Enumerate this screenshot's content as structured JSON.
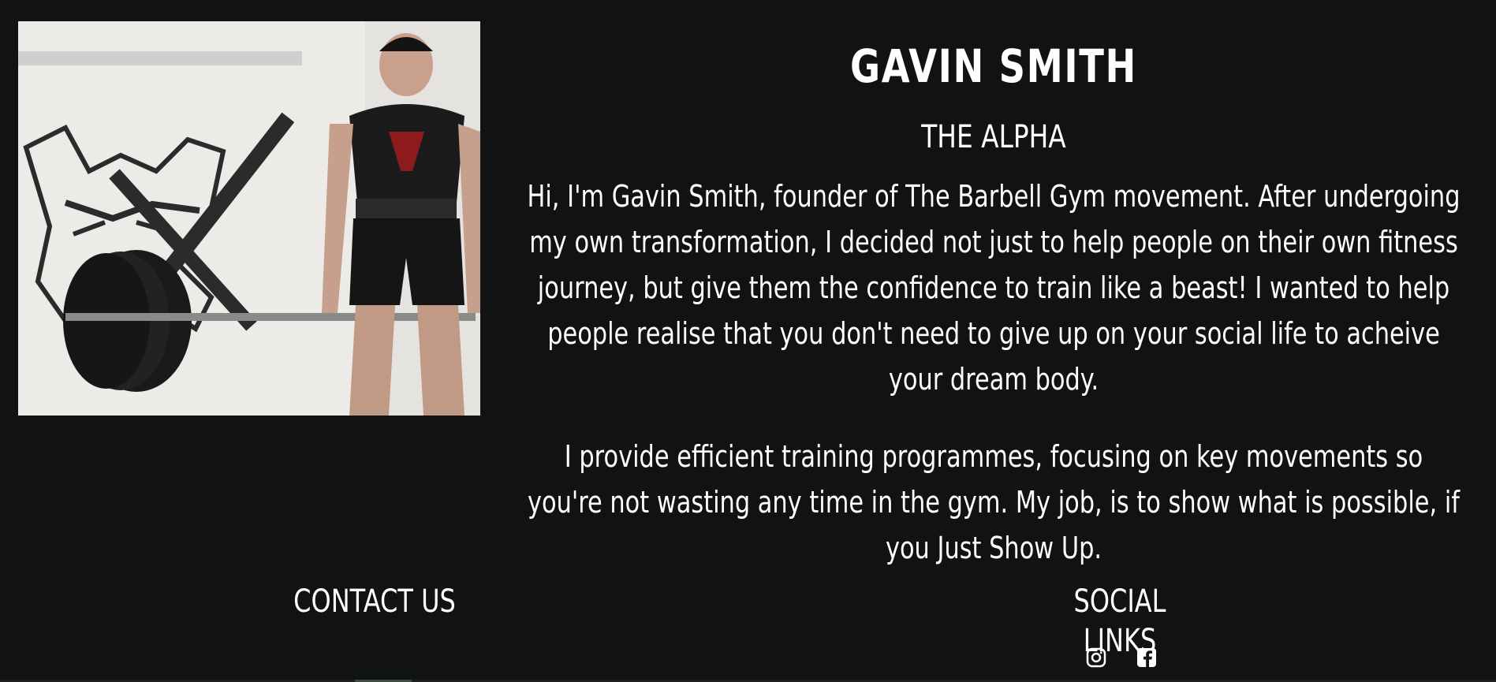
{
  "photo": {
    "alt": "Gavin Smith deadlifting a barbell"
  },
  "about": {
    "name": "GAVIN SMITH",
    "tagline": "THE ALPHA",
    "paragraph1": "Hi, I'm Gavin Smith, founder of The Barbell Gym movement. After undergoing my own transformation, I decided not just to help people on their own fitness journey, but give them the confidence to train like a beast! I wanted to help people realise that you don't need to give up on your social life to acheive your dream body.",
    "paragraph2": "I provide efficient training programmes, focusing on key movements so you're not wasting any time in the gym. My job, is to show what is possible, if you Just Show Up."
  },
  "footer": {
    "contact_heading": "CONTACT US",
    "social_heading": "SOCIAL LINKS",
    "social_icons": [
      "instagram-icon",
      "facebook-icon"
    ]
  },
  "colors": {
    "background": "#111213",
    "text": "#ffffff"
  }
}
